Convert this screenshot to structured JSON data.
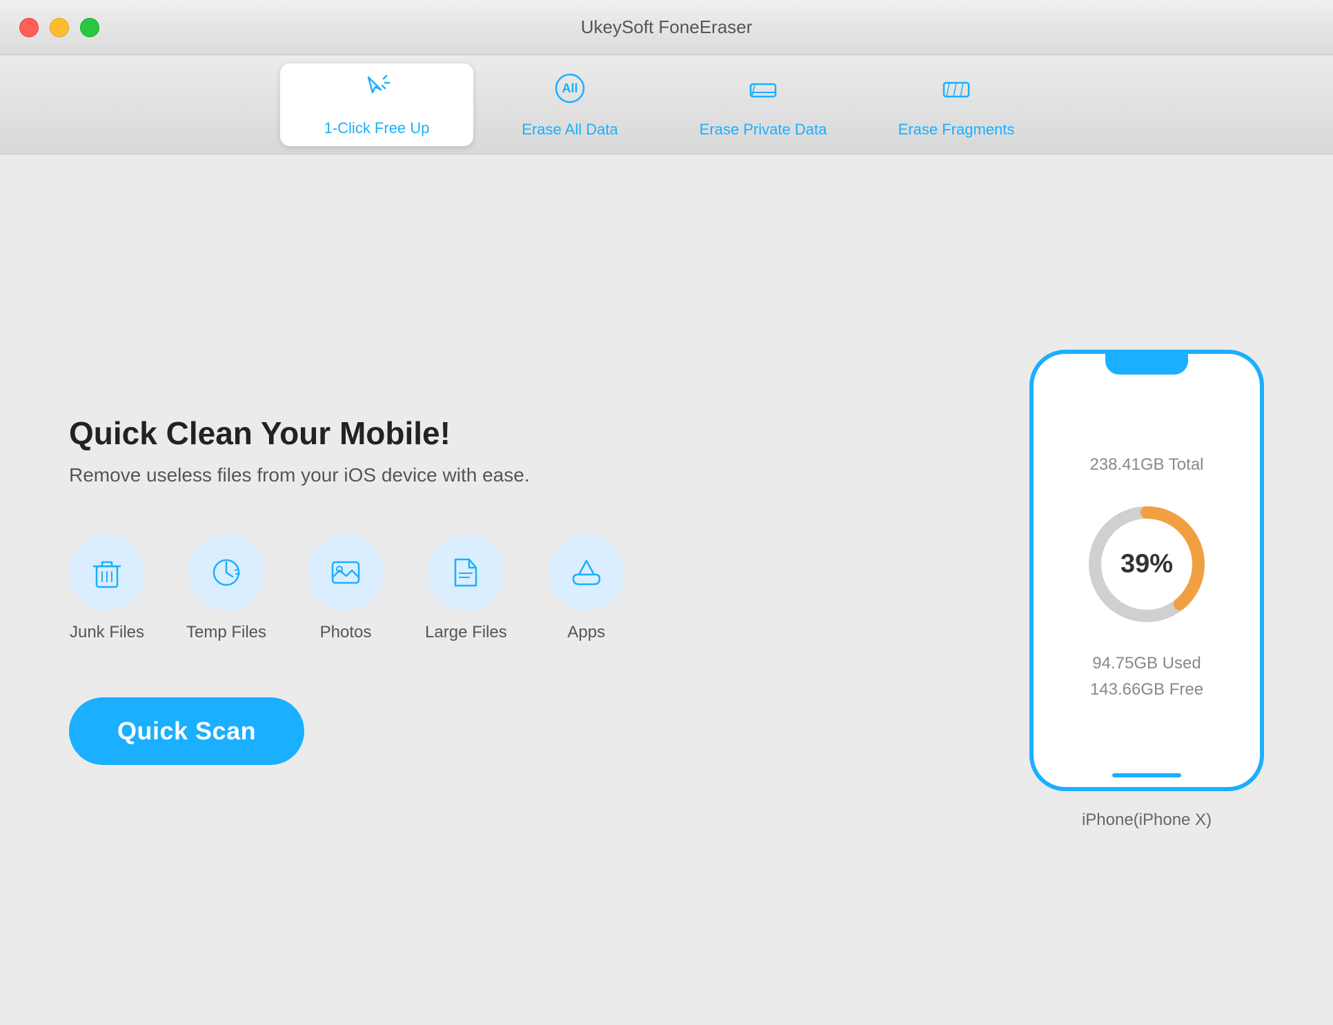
{
  "window": {
    "title": "UkeySoft FoneEraser"
  },
  "tabs": [
    {
      "id": "one-click",
      "label": "1-Click Free Up",
      "active": true
    },
    {
      "id": "erase-all",
      "label": "Erase All Data",
      "active": false
    },
    {
      "id": "erase-private",
      "label": "Erase Private Data",
      "active": false
    },
    {
      "id": "erase-fragments",
      "label": "Erase Fragments",
      "active": false
    }
  ],
  "main": {
    "headline": "Quick Clean Your Mobile!",
    "subheadline": "Remove useless files from your iOS device with ease.",
    "categories": [
      {
        "id": "junk",
        "label": "Junk Files"
      },
      {
        "id": "temp",
        "label": "Temp Files"
      },
      {
        "id": "photos",
        "label": "Photos"
      },
      {
        "id": "large",
        "label": "Large Files"
      },
      {
        "id": "apps",
        "label": "Apps"
      }
    ],
    "scan_button": "Quick Scan"
  },
  "device": {
    "total": "238.41GB Total",
    "used": "94.75GB Used",
    "free": "143.66GB Free",
    "percent": "39%",
    "percent_num": 39,
    "name": "iPhone(iPhone X)"
  },
  "colors": {
    "blue": "#1aafff",
    "orange": "#f0a040",
    "gray": "#cccccc"
  }
}
